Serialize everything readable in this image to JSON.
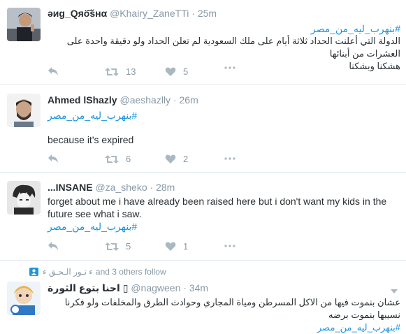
{
  "tweets": [
    {
      "name": "ǝиg_Qяӧ͂šнα",
      "handle": "@Khairy_ZaneTTi",
      "time": "25m",
      "hashtag": "#بنهرب_ليه_من_مصر",
      "text_lines": [
        "الدولة التي أعلنت الحداد ثلاثة أيام على ملك السعودية  لم تعلن الحداد ولو دقيقة واحدة على العشرات من أبنائها",
        "هشكنا وبشكنا"
      ],
      "retweets": "13",
      "likes": "5"
    },
    {
      "name": "Ahmed lShazly",
      "handle": "@aeshazlly",
      "time": "26m",
      "hashtag": "#بنهرب_ليه_من_مصر",
      "text": "because it's expired",
      "retweets": "6",
      "likes": "2"
    },
    {
      "name": "...INSANE",
      "handle": "@za_sheko",
      "time": "28m",
      "text_lines": [
        "forget about me i have already been raised here but i don't want my kids in the",
        "future see what i saw."
      ],
      "hashtag": "#بنهرب_ليه_من_مصر",
      "retweets": "5",
      "likes": "1"
    },
    {
      "social_context": "ٰ ٰ ٰ ٰ ٰ ٰ ٰ ٰ ٰ ٰ ٰ ٰ ٰ ٰ ٰ ٰ ٰ ٰ ٰ ٰ ٰ ٰ ٰ ٰ ٰ ٰ ٰ ٰ ٰ ٰ ٰ ٰ ٰ ٰ ٰ ٰ ٰ ٰ ٰ ٰ ٰ ٰ ٰ ٰ ٰ ٰ ٰ ٰ ٰ ٰ ٰ ٰ ٰ ٰ ٰ ٰ ٰ ٰ ٰ ٰ ٰ ٰ ٰ ٰ ٰ ٰ ٰ ٰ ٰ ٰ ٰ ٰ",
      "social_names": "ء نـور الـحـق ء",
      "social_suffix": "and 3 others follow",
      "name": "احنا بتوع الثورة",
      "name_icon": "▯",
      "handle": "@nagween",
      "time": "34m",
      "text_lines": [
        "عشان بنموت فيها من الاكل المسرطن ومياة المجاري وحوادث الطرق والمخلفات ولو فكرنا نسيبها بنموت برضه",
        "#بنهرب_ليه_من_مصر"
      ]
    }
  ],
  "colors": {
    "link": "#1b95e0",
    "muted": "#8899a6",
    "icon": "#aab8c2"
  }
}
